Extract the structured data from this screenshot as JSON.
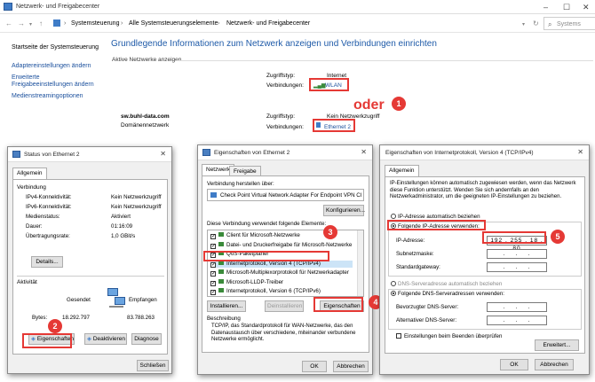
{
  "window": {
    "title": "Netzwerk- und Freigabecenter",
    "breadcrumb": [
      "Systemsteuerung",
      "Alle Systemsteuerungselemente",
      "Netzwerk- und Freigabecenter"
    ],
    "search_hint": "Systems"
  },
  "sidebar": {
    "items": [
      "Startseite der Systemsteuerung",
      "Adaptereinstellungen ändern",
      "Erweiterte Freigabeeinstellungen ändern",
      "Medienstreamingoptionen"
    ]
  },
  "main": {
    "heading": "Grundlegende Informationen zum Netzwerk anzeigen und Verbindungen einrichten",
    "active_networks": "Aktive Netzwerke anzeigen",
    "net1": {
      "access_label": "Zugriffstyp:",
      "access": "Internet",
      "conn_label": "Verbindungen:",
      "conn": "WLAN"
    },
    "net2": {
      "name": "sw.buhl-data.com",
      "type": "Domänennetzwerk",
      "access_label": "Zugriffstyp:",
      "access": "Kein Netzwerkzugriff",
      "conn_label": "Verbindungen:",
      "conn": "Ethernet 2"
    },
    "oder": "oder"
  },
  "status": {
    "title": "Status von Ethernet 2",
    "tab": "Allgemein",
    "group_conn": "Verbindung",
    "rows": [
      {
        "k": "IPv4-Konnektivität:",
        "v": "Kein Netzwerkzugriff"
      },
      {
        "k": "IPv6-Konnektivität:",
        "v": "Kein Netzwerkzugriff"
      },
      {
        "k": "Medienstatus:",
        "v": "Aktiviert"
      },
      {
        "k": "Dauer:",
        "v": "01:16:09"
      },
      {
        "k": "Übertragungsrate:",
        "v": "1,0 GBit/s"
      }
    ],
    "details": "Details...",
    "group_activity": "Aktivität",
    "sent": "Gesendet",
    "received": "Empfangen",
    "bytes_label": "Bytes:",
    "bytes_sent": "18.292.797",
    "bytes_received": "83.788.263",
    "btn_props": "Eigenschaften",
    "btn_disable": "Deaktivieren",
    "btn_diag": "Diagnose",
    "btn_close": "Schließen"
  },
  "props": {
    "title": "Eigenschaften von Ethernet 2",
    "tab1": "Netzwerk",
    "tab2": "Freigabe",
    "connect_using": "Verbindung herstellen über:",
    "adapter": "Check Point Virtual Network Adapter For Endpoint VPN Cl",
    "configure": "Konfigurieren...",
    "items_label": "Diese Verbindung verwendet folgende Elemente:",
    "items": [
      "Client für Microsoft-Netzwerke",
      "Datei- und Druckerfreigabe für Microsoft-Netzwerke",
      "QoS-Paketplaner",
      "Internetprotokoll, Version 4 (TCP/IPv4)",
      "Microsoft-Multiplexorprotokoll für Netzwerkadapter",
      "Microsoft-LLDP-Treiber",
      "Internetprotokoll, Version 6 (TCP/IPv6)"
    ],
    "install": "Installieren...",
    "uninstall": "Deinstallieren",
    "properties": "Eigenschaften",
    "desc_label": "Beschreibung",
    "desc": "TCP/IP, das Standardprotokoll für WAN-Netzwerke, das den Datenaustausch über verschiedene, miteinander verbundene Netzwerke ermöglicht.",
    "ok": "OK",
    "cancel": "Abbrechen"
  },
  "ipv4": {
    "title": "Eigenschaften von Internetprotokoll, Version 4 (TCP/IPv4)",
    "tab": "Allgemein",
    "intro": "IP-Einstellungen können automatisch zugewiesen werden, wenn das Netzwerk diese Funktion unterstützt. Wenden Sie sich andernfalls an den Netzwerkadministrator, um die geeigneten IP-Einstellungen zu beziehen.",
    "auto_ip": "IP-Adresse automatisch beziehen",
    "manual_ip": "Folgende IP-Adresse verwenden:",
    "ip_label": "IP-Adresse:",
    "ip_value": "192 . 255 . 18 . 80",
    "mask_label": "Subnetzmaske:",
    "gw_label": "Standardgateway:",
    "auto_dns": "DNS-Serveradresse automatisch beziehen",
    "manual_dns": "Folgende DNS-Serveradressen verwenden:",
    "dns1_label": "Bevorzugter DNS-Server:",
    "dns2_label": "Alternativer DNS-Server:",
    "validate": "Einstellungen beim Beenden überprüfen",
    "advanced": "Erweitert...",
    "ok": "OK",
    "cancel": "Abbrechen"
  },
  "steps": [
    "1",
    "2",
    "3",
    "4",
    "5"
  ],
  "colors": {
    "accent": "#1e5aa8",
    "highlight": "#e53935"
  }
}
